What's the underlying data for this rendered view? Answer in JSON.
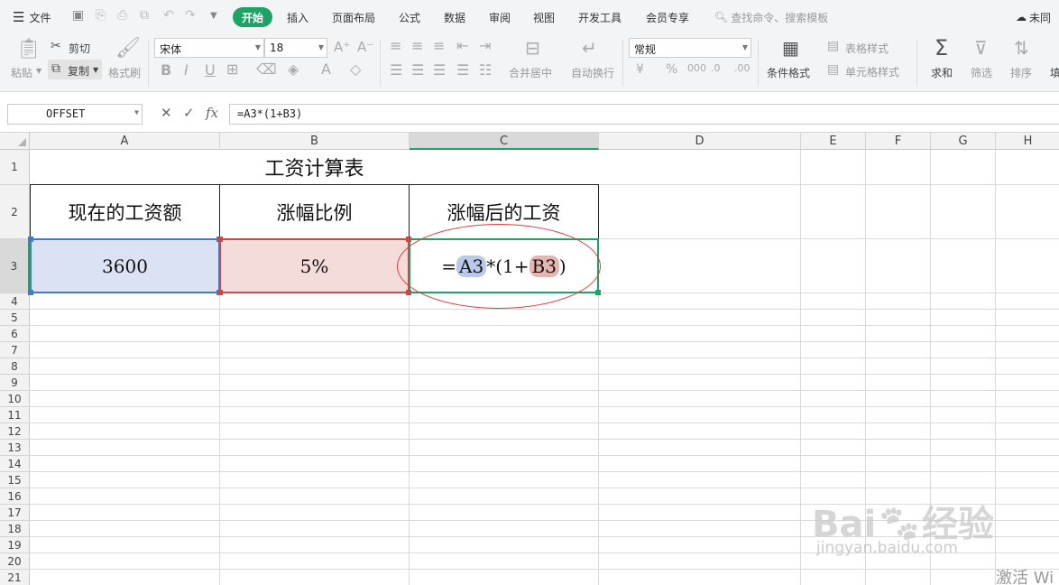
{
  "menubar": {
    "file_label": "文件",
    "tabs": [
      "开始",
      "插入",
      "页面布局",
      "公式",
      "数据",
      "审阅",
      "视图",
      "开发工具",
      "会员专享"
    ],
    "search_placeholder": "查找命令、搜索模板",
    "right_label": "未同"
  },
  "ribbon": {
    "paste": "粘贴",
    "cut": "剪切",
    "copy": "复制",
    "format_painter": "格式刷",
    "font_name": "宋体",
    "font_size": "18",
    "merge_center": "合并居中",
    "wrap_text": "自动换行",
    "number_format": "常规",
    "conditional_format": "条件格式",
    "table_style": "表格样式",
    "cell_style": "单元格样式",
    "sum": "求和",
    "filter": "筛选",
    "sort": "排序",
    "fill": "填"
  },
  "formula_bar": {
    "name_box": "OFFSET",
    "fx": "fx",
    "formula": "=A3*(1+B3)"
  },
  "grid": {
    "columns": [
      "A",
      "B",
      "C",
      "D",
      "E",
      "F",
      "G",
      "H"
    ],
    "rows": [
      "1",
      "2",
      "3",
      "4",
      "5",
      "6",
      "7",
      "8",
      "9",
      "10",
      "11",
      "12",
      "13",
      "14",
      "15",
      "16",
      "17",
      "18",
      "19",
      "20",
      "21"
    ],
    "selected_column": "C",
    "selected_row": "3"
  },
  "sheet": {
    "title": "工资计算表",
    "header_a": "现在的工资额",
    "header_b": "涨幅比例",
    "header_c": "涨幅后的工资",
    "a3": "3600",
    "b3": "5%",
    "c3": {
      "eq": "=",
      "ref1": "A3",
      "mid": "*(1+",
      "ref2": "B3",
      "end": ")"
    }
  },
  "watermark": {
    "brand": "Bai",
    "brand2": "经验",
    "url": "jingyan.baidu.com",
    "activate": "激活 Wi"
  },
  "colors": {
    "accent": "#1ea366",
    "a3_fill": "#dae2f3",
    "b3_fill": "#f4dcdb",
    "annotation": "#e23b3b"
  }
}
